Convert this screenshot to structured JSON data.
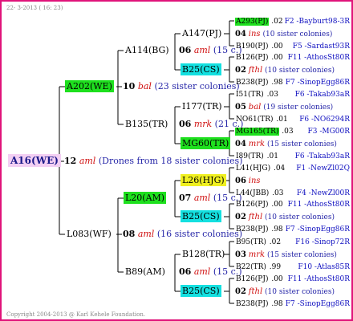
{
  "header": {
    "text": "22-  3-2013 ( 16: 23)"
  },
  "footer": {
    "text": "Copyright 2004-2013 @ Karl Kehele Foundation."
  },
  "colors": {
    "green": "#1ee01e",
    "cyan": "#14e0e0",
    "yellow": "#f0f020",
    "pink": "#f3cff3",
    "border": "#e0137a"
  },
  "root": {
    "label": "A16(WE)",
    "num": "12",
    "sub": "aml",
    "sis": "(Drones from 18 sister colonies)"
  },
  "g1": [
    {
      "label": "A202(WE)",
      "hl": "green",
      "num": "10",
      "sub": "bal",
      "sis": "(23 sister colonies)"
    },
    {
      "label": "L083(WF)",
      "hl": "",
      "num": "08",
      "sub": "aml",
      "sis": "(16 sister colonies)"
    }
  ],
  "g2": [
    {
      "label": "A114(BG)",
      "hl": "",
      "num": "06",
      "sub": "aml",
      "sis": "(15 c.)"
    },
    {
      "label": "B135(TR)",
      "hl": "",
      "num": "06",
      "sub": "mrk",
      "sis": "(21 c.)"
    },
    {
      "label": "L20(AM)",
      "hl": "green",
      "num": "07",
      "sub": "aml",
      "sis": "(15 c.)"
    },
    {
      "label": "B89(AM)",
      "hl": "",
      "num": "06",
      "sub": "aml",
      "sis": "(15 c.)"
    }
  ],
  "g3": [
    {
      "label": "A147(PJ)",
      "hl": ""
    },
    {
      "label": "B25(CS)",
      "hl": "cyan"
    },
    {
      "label": "I177(TR)",
      "hl": ""
    },
    {
      "label": "MG60(TR)",
      "hl": "green"
    },
    {
      "label": "L26(HJG)",
      "hl": "yellow"
    },
    {
      "label": "B25(CS)",
      "hl": "cyan"
    },
    {
      "label": "B128(TR)",
      "hl": ""
    },
    {
      "label": "B25(CS)",
      "hl": "cyan"
    }
  ],
  "g4": [
    [
      {
        "type": "p",
        "label": "A293(PJ)",
        "hl": "green",
        "val": ".02",
        "right": "F2 -Bayburt98-3R"
      },
      {
        "type": "s",
        "num": "04",
        "sub": "ins",
        "sis": "(10 sister colonies)"
      },
      {
        "type": "p",
        "label": "B190(PJ)",
        "hl": "",
        "val": ".00",
        "right": "F5 -Sardast93R"
      }
    ],
    [
      {
        "type": "p",
        "label": "B126(PJ)",
        "hl": "",
        "val": ".00",
        "right": "F11 -AthosSt80R"
      },
      {
        "type": "s",
        "num": "02",
        "sub": "fthl",
        "sis": "(10 sister colonies)"
      },
      {
        "type": "p",
        "label": "B238(PJ)",
        "hl": "",
        "val": ".98",
        "right": "F7 -SinopEgg86R"
      }
    ],
    [
      {
        "type": "p",
        "label": "I51(TR)",
        "hl": "",
        "val": ".03",
        "right": "F6 -Takab93aR"
      },
      {
        "type": "s",
        "num": "05",
        "sub": "bal",
        "sis": "(19 sister colonies)"
      },
      {
        "type": "p",
        "label": "NO61(TR)",
        "hl": "",
        "val": ".01",
        "right": "F6 -NO6294R"
      }
    ],
    [
      {
        "type": "p",
        "label": "MG165(TR)",
        "hl": "green",
        "val": ".03",
        "right": "F3 -MG00R"
      },
      {
        "type": "s",
        "num": "04",
        "sub": "mrk",
        "sis": "(15 sister colonies)"
      },
      {
        "type": "p",
        "label": "I89(TR)",
        "hl": "",
        "val": ".01",
        "right": "F6 -Takab93aR"
      }
    ],
    [
      {
        "type": "p",
        "label": "L41(HJG)",
        "hl": "",
        "val": ".04",
        "right": "F1 -NewZl02Q"
      },
      {
        "type": "s",
        "num": "06",
        "sub": "ins",
        "sis": ""
      },
      {
        "type": "p",
        "label": "L44(JBB)",
        "hl": "",
        "val": ".03",
        "right": "F4 -NewZl00R"
      }
    ],
    [
      {
        "type": "p",
        "label": "B126(PJ)",
        "hl": "",
        "val": ".00",
        "right": "F11 -AthosSt80R"
      },
      {
        "type": "s",
        "num": "02",
        "sub": "fthl",
        "sis": "(10 sister colonies)"
      },
      {
        "type": "p",
        "label": "B238(PJ)",
        "hl": "",
        "val": ".98",
        "right": "F7 -SinopEgg86R"
      }
    ],
    [
      {
        "type": "p",
        "label": "B95(TR)",
        "hl": "",
        "val": ".02",
        "right": "F16 -Sinop72R"
      },
      {
        "type": "s",
        "num": "03",
        "sub": "mrk",
        "sis": "(15 sister colonies)"
      },
      {
        "type": "p",
        "label": "B22(TR)",
        "hl": "",
        "val": ".99",
        "right": "F10 -Atlas85R"
      }
    ],
    [
      {
        "type": "p",
        "label": "B126(PJ)",
        "hl": "",
        "val": ".00",
        "right": "F11 -AthosSt80R"
      },
      {
        "type": "s",
        "num": "02",
        "sub": "fthl",
        "sis": "(10 sister colonies)"
      },
      {
        "type": "p",
        "label": "B238(PJ)",
        "hl": "",
        "val": ".98",
        "right": "F7 -SinopEgg86R"
      }
    ]
  ]
}
